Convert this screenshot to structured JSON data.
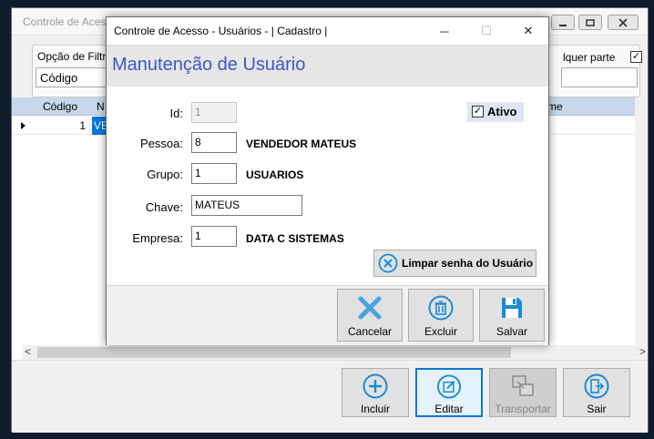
{
  "background_window": {
    "title": "Controle de Acess",
    "filter": {
      "label": "Opção de Filtro",
      "selected": "Código",
      "part_label": "lquer parte",
      "part_checked": "✓"
    },
    "grid": {
      "columns": [
        "Código",
        "N",
        "me"
      ],
      "rows": [
        {
          "codigo": "1",
          "nome": "VE"
        }
      ]
    },
    "buttons": {
      "incluir": "Incluir",
      "editar": "Editar",
      "transportar": "Transportar",
      "sair": "Sair"
    }
  },
  "dialog": {
    "title": "Controle de Acesso - Usuários - | Cadastro |",
    "heading": "Manutenção de Usuário",
    "fields": {
      "id": {
        "label": "Id:",
        "value": "1"
      },
      "pessoa": {
        "label": "Pessoa:",
        "value": "8",
        "description": "VENDEDOR MATEUS"
      },
      "grupo": {
        "label": "Grupo:",
        "value": "1",
        "description": "USUARIOS"
      },
      "chave": {
        "label": "Chave:",
        "value": "MATEUS"
      },
      "empresa": {
        "label": "Empresa:",
        "value": "1",
        "description": "DATA C SISTEMAS"
      }
    },
    "ativo": {
      "label": "Ativo",
      "checked": "✓"
    },
    "clear_password_label": "Limpar senha do Usuário",
    "buttons": {
      "cancelar": "Cancelar",
      "excluir": "Excluir",
      "salvar": "Salvar"
    },
    "window_controls": {
      "minimize": "─",
      "maximize": "☐",
      "close": "✕"
    }
  },
  "colors": {
    "accent": "#0078d7",
    "heading": "#3b57c8",
    "icon_blue": "#1a8bd6",
    "cancel_icon": "#4aa3e0"
  }
}
